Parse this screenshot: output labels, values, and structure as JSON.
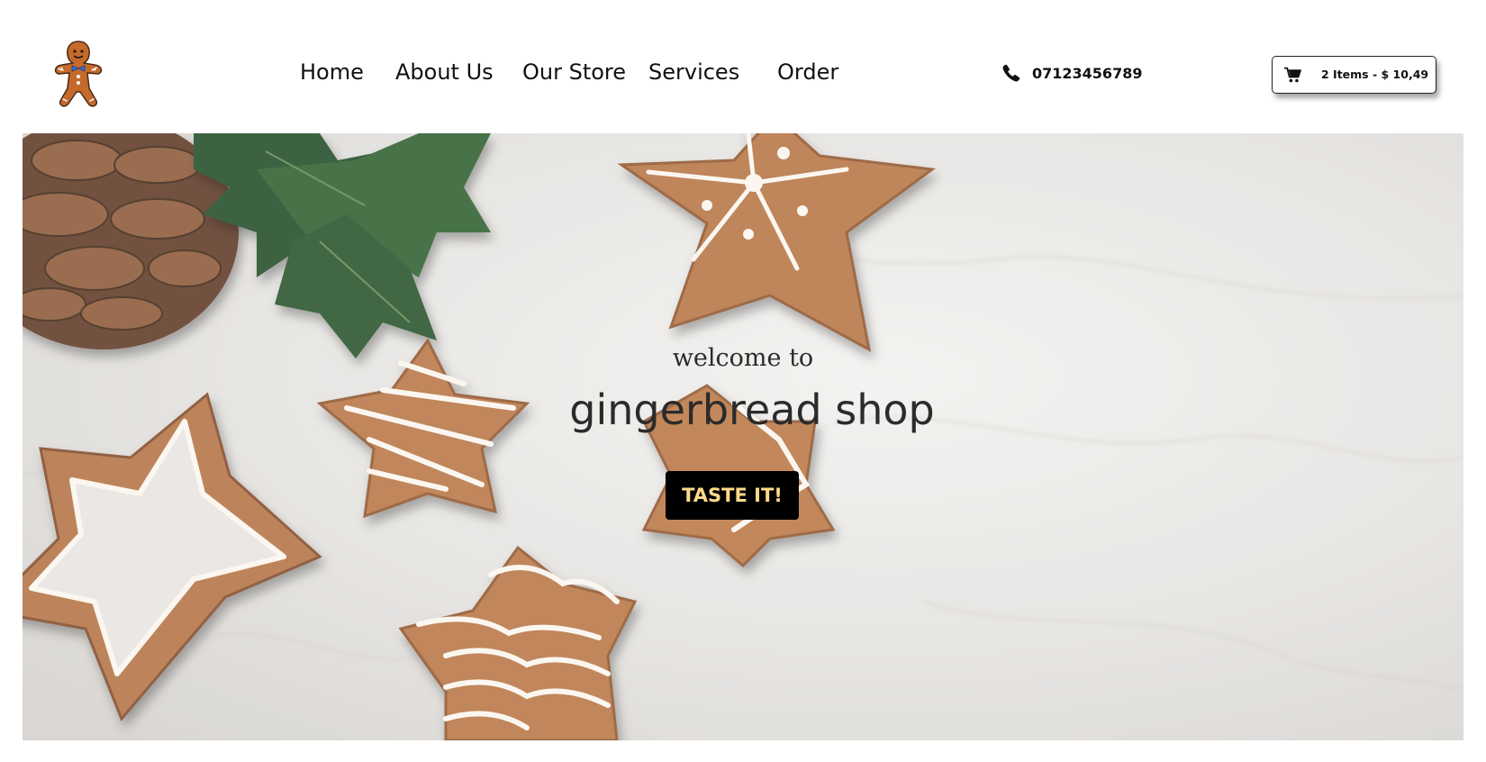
{
  "brand": {
    "logo_icon": "gingerbread-man-icon"
  },
  "nav": {
    "items": [
      {
        "label": "Home"
      },
      {
        "label": "About Us"
      },
      {
        "label": "Our Store"
      },
      {
        "label": "Services"
      },
      {
        "label": "Order"
      }
    ]
  },
  "contact": {
    "phone_icon": "phone-icon",
    "phone_number": "07123456789"
  },
  "cart": {
    "icon": "cart-icon",
    "summary": "2 Items - $ 10,49"
  },
  "hero": {
    "welcome": "welcome to",
    "title": "gingerbread shop",
    "cta_label": "TASTE IT!"
  },
  "colors": {
    "cta_background": "#000000",
    "cta_text": "#ffd98a",
    "cookie": "#b97a4a",
    "icing": "#fbf6ee"
  }
}
